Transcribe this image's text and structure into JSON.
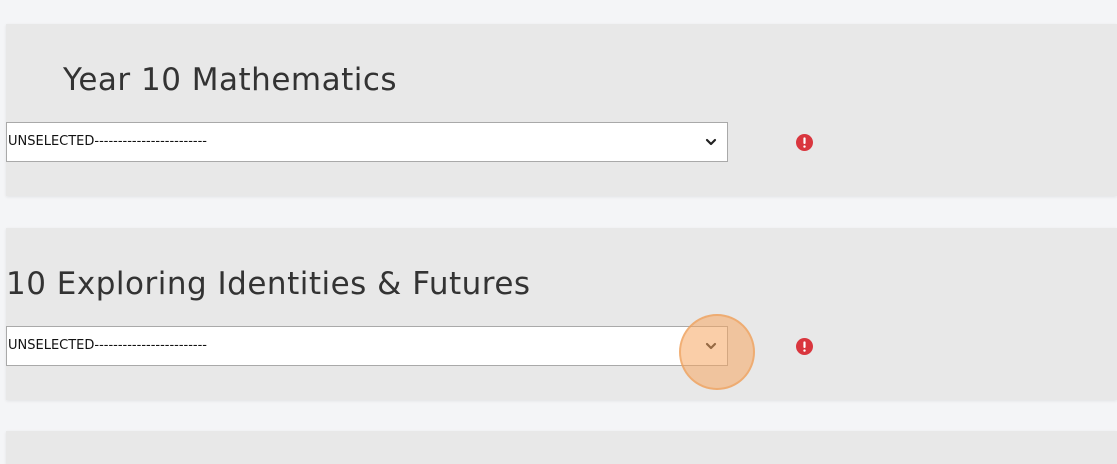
{
  "subjects": [
    {
      "title": "Year 10 Mathematics",
      "select_value": "UNSELECTED------------------------"
    },
    {
      "title": "10 Exploring Identities & Futures",
      "select_value": "UNSELECTED------------------------"
    }
  ],
  "colors": {
    "panel_bg": "#e8e8e8",
    "page_bg": "#f4f5f7",
    "alert_red": "#d9363e",
    "click_highlight": "#f5a660"
  },
  "icons": {
    "dropdown": "chevron-down-icon",
    "alert": "exclamation-alert-icon"
  }
}
